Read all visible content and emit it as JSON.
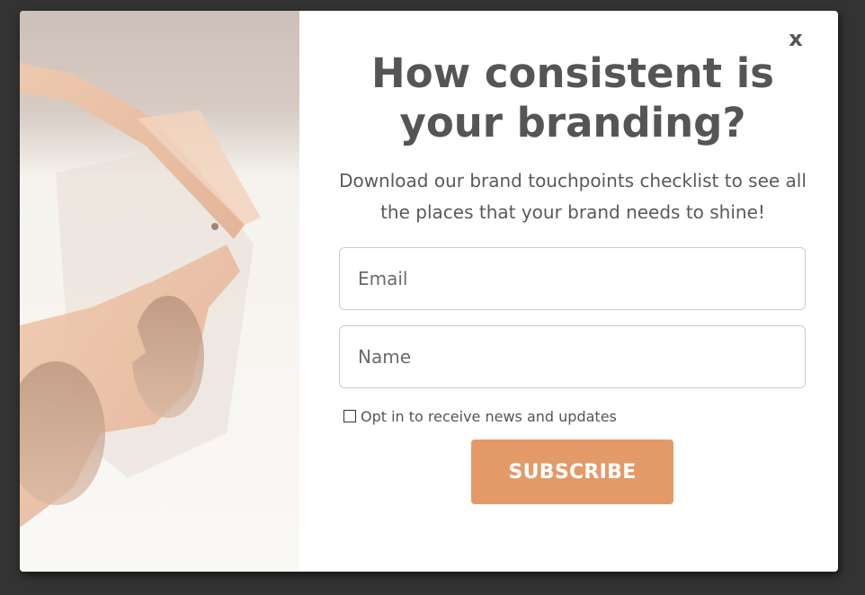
{
  "popup": {
    "close_label": "x",
    "title": "How consistent is your branding?",
    "subtitle": "Download our brand touchpoints checklist to see all the places that your brand needs to shine!",
    "email_placeholder": "Email",
    "name_placeholder": "Name",
    "optin_label": "Opt in to receive news and updates",
    "optin_checked": false,
    "subscribe_label": "SUBSCRIBE"
  },
  "colors": {
    "backdrop": "#333333",
    "panel": "#ffffff",
    "text": "#555555",
    "button": "#e39a68",
    "button_text": "#ffffff",
    "field_border": "#cccccc"
  },
  "image": {
    "subject": "peach-tinted sunglasses on white surface"
  }
}
